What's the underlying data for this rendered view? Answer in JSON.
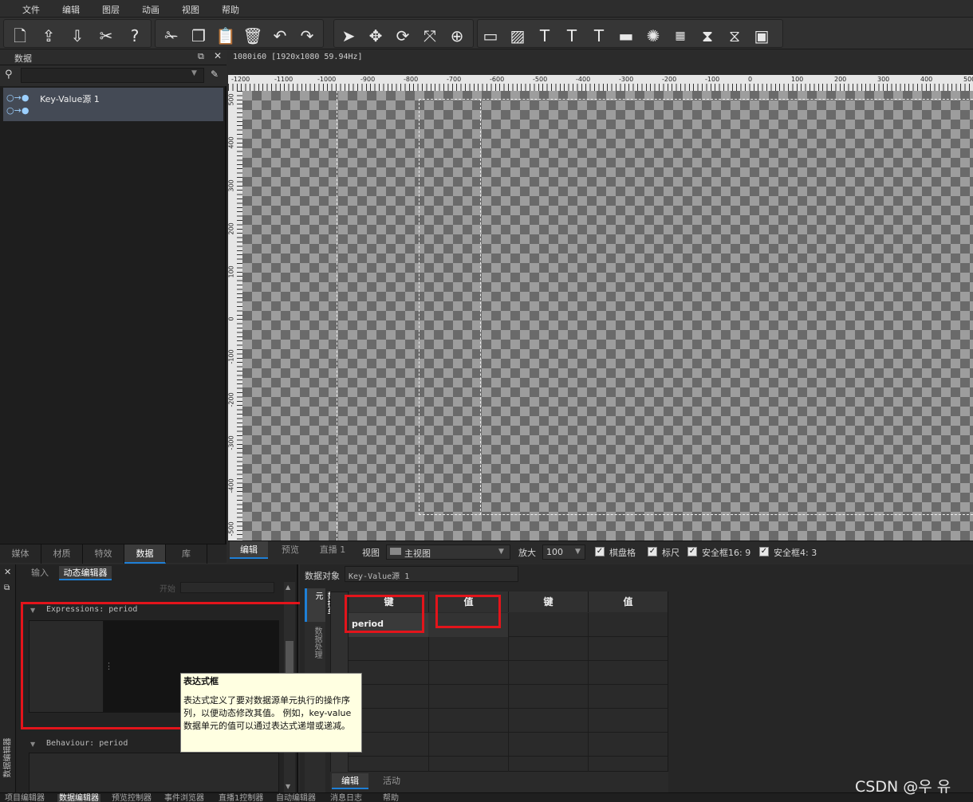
{
  "menu": [
    "文件",
    "编辑",
    "图层",
    "动画",
    "视图",
    "帮助"
  ],
  "data_panel": {
    "title": "数据",
    "item_label": "Key-Value源 1",
    "tabs": [
      "媒体",
      "材质",
      "特效",
      "数据",
      "库"
    ],
    "active_tab": "数据"
  },
  "canvas": {
    "format_info": "1080i60 [1920x1080 59.94Hz]",
    "ruler_top_labels": [
      "-1200",
      "-1100",
      "-1000",
      "-900",
      "-800",
      "-700",
      "-600",
      "-500",
      "-400",
      "-300",
      "-200",
      "-100",
      "0",
      "100",
      "200",
      "300",
      "400",
      "500"
    ],
    "ruler_left_labels": [
      "500",
      "400",
      "300",
      "200",
      "100",
      "0",
      "-100",
      "-200",
      "-300",
      "-400",
      "-500"
    ]
  },
  "view_bar": {
    "tabs": [
      "编辑",
      "预览",
      "直播 1"
    ],
    "view_label": "视图",
    "view_value": "主视图",
    "zoom_label": "放大",
    "zoom_value": "100",
    "checks": [
      "棋盘格",
      "标尺",
      "安全框16: 9",
      "安全框4: 3"
    ]
  },
  "bottom_left": {
    "tabs": [
      "输入",
      "动态编辑器"
    ],
    "side_label": "数据编辑器",
    "greyed_label": "开始",
    "expressions_title": "Expressions: period",
    "behaviour_title": "Behaviour: period"
  },
  "tooltip": {
    "title": "表达式框",
    "body": "表达式定义了要对数据源单元执行的操作序列，以便动态修改其值。 例如，key-value数据单元的值可以通过表达式递增或递减。"
  },
  "bottom_right": {
    "data_object_label": "数据对象",
    "data_object_value": "Key-Value源 1",
    "side_tabs": [
      "数据单元",
      "数据处理"
    ],
    "headers": [
      "键",
      "值",
      "键",
      "值"
    ],
    "row_key": "period",
    "bottom_tabs": [
      "编辑",
      "活动"
    ]
  },
  "status_bar": [
    "项目编辑器",
    "数据编辑器",
    "预览控制器",
    "事件浏览器",
    "直播1控制器",
    "自动编辑器",
    "消息日志",
    "帮助"
  ],
  "watermark": "CSDN @우 유",
  "colors": {
    "highlight": "#e3141b",
    "accent": "#1e7fd6"
  }
}
